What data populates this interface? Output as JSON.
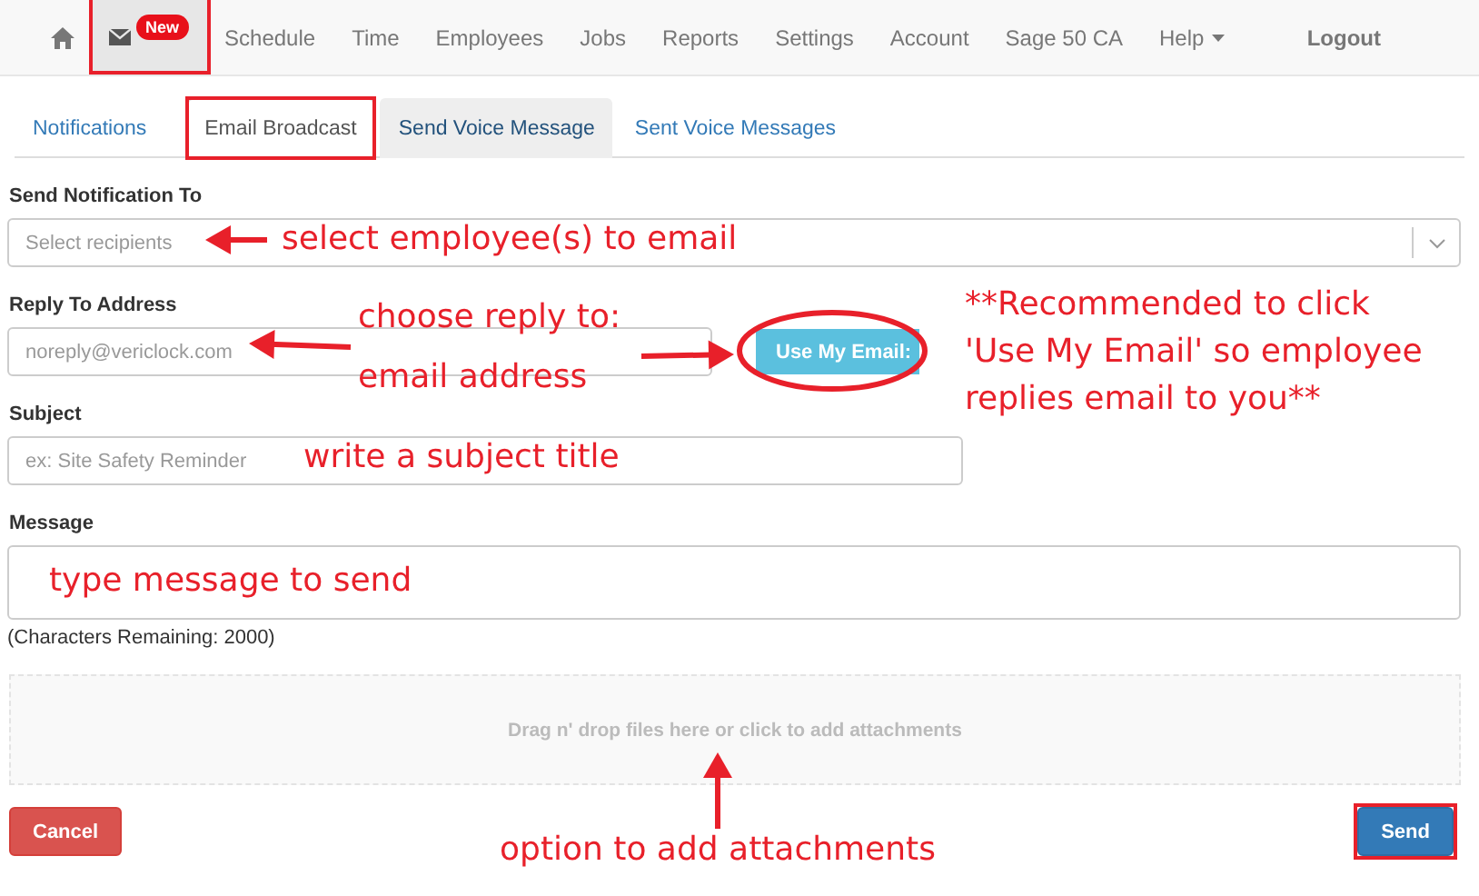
{
  "nav": {
    "items": [
      {
        "kind": "home"
      },
      {
        "kind": "mail",
        "badge": "New",
        "highlighted": true
      },
      {
        "kind": "link",
        "label": "Schedule"
      },
      {
        "kind": "link",
        "label": "Time"
      },
      {
        "kind": "link",
        "label": "Employees"
      },
      {
        "kind": "link",
        "label": "Jobs"
      },
      {
        "kind": "link",
        "label": "Reports"
      },
      {
        "kind": "link",
        "label": "Settings"
      },
      {
        "kind": "link",
        "label": "Account"
      },
      {
        "kind": "link",
        "label": "Sage 50 CA"
      },
      {
        "kind": "dropdown",
        "label": "Help"
      },
      {
        "kind": "logout",
        "label": "Logout"
      }
    ]
  },
  "tabs": [
    {
      "label": "Notifications",
      "selected": false,
      "hovered": false,
      "highlighted": false
    },
    {
      "label": "Email Broadcast",
      "selected": true,
      "hovered": false,
      "highlighted": true
    },
    {
      "label": "Send Voice Message",
      "selected": false,
      "hovered": true,
      "highlighted": false
    },
    {
      "label": "Sent Voice Messages",
      "selected": false,
      "hovered": false,
      "highlighted": false
    }
  ],
  "form": {
    "recipients": {
      "label": "Send Notification To",
      "placeholder": "Select recipients",
      "note": "select employee(s) to email"
    },
    "reply_to": {
      "label": "Reply To Address",
      "placeholder": "noreply@vericlock.com",
      "note": [
        "choose reply to:",
        "email address"
      ],
      "button": {
        "label": "Use My Email:",
        "circled": true
      },
      "tip": [
        "**Recommended to click",
        "'Use My Email' so employee",
        "replies email to you**"
      ]
    },
    "subject": {
      "label": "Subject",
      "placeholder": "ex: Site Safety Reminder",
      "note": "write a subject title"
    },
    "message": {
      "label": "Message",
      "note": "type message to send",
      "counter": "(Characters Remaining: 2000)"
    },
    "dropzone": {
      "text": "Drag n' drop files here or click to add attachments",
      "note": "option to add attachments"
    },
    "cancel": {
      "label": "Cancel"
    },
    "send": {
      "label": "Send",
      "highlighted": true
    }
  }
}
